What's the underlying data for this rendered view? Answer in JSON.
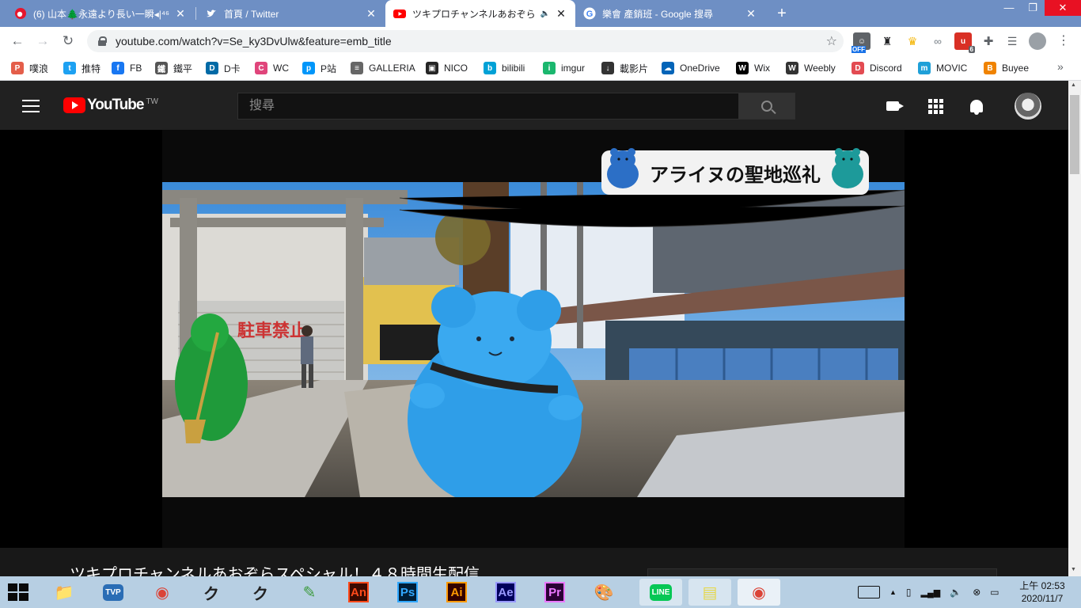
{
  "browser": {
    "tabs": [
      {
        "title": "(6) 山本🌲永遠より長い一瞬◂|⁴⁶",
        "favicon": "weibo-icon",
        "active": false
      },
      {
        "title": "首頁 / Twitter",
        "favicon": "twitter-icon",
        "active": false
      },
      {
        "title": "ツキプロチャンネルあおぞら",
        "favicon": "youtube-icon",
        "active": true,
        "audio": "🔈"
      },
      {
        "title": "樂會 產銷班 - Google 搜尋",
        "favicon": "google-icon",
        "active": false
      }
    ],
    "new_tab": "+",
    "window_controls": {
      "minimize": "—",
      "restore": "❐",
      "close": "✕"
    },
    "nav": {
      "back": "←",
      "forward": "→",
      "reload": "↻"
    },
    "url": "youtube.com/watch?v=Se_ky3DvUlw&feature=emb_title",
    "bookmark_star": "☆",
    "extensions": [
      {
        "name": "off-extension-icon",
        "badge": "OFF",
        "color": "#5f6368"
      },
      {
        "name": "spy-extension-icon",
        "color": "#202124"
      },
      {
        "name": "crown-extension-icon",
        "color": "#f4b400"
      },
      {
        "name": "glasses-extension-icon",
        "color": "#9aa0a6"
      },
      {
        "name": "ublock-extension-icon",
        "badge": "6",
        "color": "#d93025"
      },
      {
        "name": "puzzle-extension-icon",
        "color": "#5f6368"
      },
      {
        "name": "playlist-extension-icon",
        "color": "#5f6368"
      }
    ],
    "menu": "⋮"
  },
  "bookmarks": [
    {
      "label": "噗浪",
      "icon": "plurk-icon",
      "color": "#e45e4a",
      "glyph": "P"
    },
    {
      "label": "推特",
      "icon": "twitter-icon",
      "color": "#1da1f2",
      "glyph": "t"
    },
    {
      "label": "FB",
      "icon": "facebook-icon",
      "color": "#1877f2",
      "glyph": "f"
    },
    {
      "label": "鐵平",
      "icon": "avatar-icon",
      "color": "#555555",
      "glyph": "鐵"
    },
    {
      "label": "D卡",
      "icon": "dcard-icon",
      "color": "#006aa6",
      "glyph": "D"
    },
    {
      "label": "WC",
      "icon": "wc-icon",
      "color": "#e0457b",
      "glyph": "C"
    },
    {
      "label": "P站",
      "icon": "pixiv-icon",
      "color": "#0096fa",
      "glyph": "p"
    },
    {
      "label": "GALLERIA",
      "icon": "galleria-icon",
      "color": "#666666",
      "glyph": "≡"
    },
    {
      "label": "NICO",
      "icon": "niconico-icon",
      "color": "#252525",
      "glyph": "▣"
    },
    {
      "label": "bilibili",
      "icon": "bilibili-icon",
      "color": "#00a1d6",
      "glyph": "b"
    },
    {
      "label": "imgur",
      "icon": "imgur-icon",
      "color": "#1bb76e",
      "glyph": "i"
    },
    {
      "label": "載影片",
      "icon": "download-icon",
      "color": "#333333",
      "glyph": "↓"
    },
    {
      "label": "OneDrive",
      "icon": "onedrive-icon",
      "color": "#0364b8",
      "glyph": "☁"
    },
    {
      "label": "Wix",
      "icon": "wix-icon",
      "color": "#000000",
      "glyph": "W"
    },
    {
      "label": "Weebly",
      "icon": "weebly-icon",
      "color": "#333333",
      "glyph": "W"
    },
    {
      "label": "Discord",
      "icon": "discord-icon",
      "color": "#e34b52",
      "glyph": "D"
    },
    {
      "label": "MOVIC",
      "icon": "movic-icon",
      "color": "#1fa0d8",
      "glyph": "m"
    },
    {
      "label": "Buyee",
      "icon": "buyee-icon",
      "color": "#f08300",
      "glyph": "B"
    }
  ],
  "bookmarks_more": "»",
  "youtube": {
    "logo_text": "YouTube",
    "region": "TW",
    "search_placeholder": "搜尋",
    "video_caption": "アライヌの聖地巡礼",
    "video_title": "ツキプロチャンネルあおぞらスペシャル！４８時間生配信"
  },
  "taskbar": {
    "apps": [
      {
        "name": "file-explorer-icon",
        "glyph": "📁",
        "color": "#e8b923"
      },
      {
        "name": "tvp-icon",
        "glyph": "TVP",
        "color": "#2a6db5"
      },
      {
        "name": "chrome-icon",
        "glyph": "◉",
        "color": "#db4437"
      },
      {
        "name": "clip-studio-icon",
        "glyph": "ク",
        "color": "#222222"
      },
      {
        "name": "clip-studio-paint-icon",
        "glyph": "ク",
        "color": "#222222"
      },
      {
        "name": "paint-tool-icon",
        "glyph": "✎",
        "color": "#3c9a3c"
      },
      {
        "name": "animate-icon",
        "glyph": "An",
        "color": "#ff4a1a",
        "bg": "#3a0a00"
      },
      {
        "name": "photoshop-icon",
        "glyph": "Ps",
        "color": "#31a8ff",
        "bg": "#001e36"
      },
      {
        "name": "illustrator-icon",
        "glyph": "Ai",
        "color": "#ff9a00",
        "bg": "#330000"
      },
      {
        "name": "after-effects-icon",
        "glyph": "Ae",
        "color": "#9999ff",
        "bg": "#00005b"
      },
      {
        "name": "premiere-icon",
        "glyph": "Pr",
        "color": "#ea77ff",
        "bg": "#2a0034"
      },
      {
        "name": "palette-icon",
        "glyph": "🎨",
        "color": "#c77"
      },
      {
        "name": "line-icon",
        "glyph": "LINE",
        "color": "#06c755"
      },
      {
        "name": "sticky-notes-icon",
        "glyph": "▤",
        "color": "#e6d84a"
      },
      {
        "name": "chrome-window-icon",
        "glyph": "◉",
        "color": "#db4437"
      }
    ],
    "clock_period": "上午",
    "clock_time": "02:53",
    "clock_date": "2020/11/7"
  }
}
